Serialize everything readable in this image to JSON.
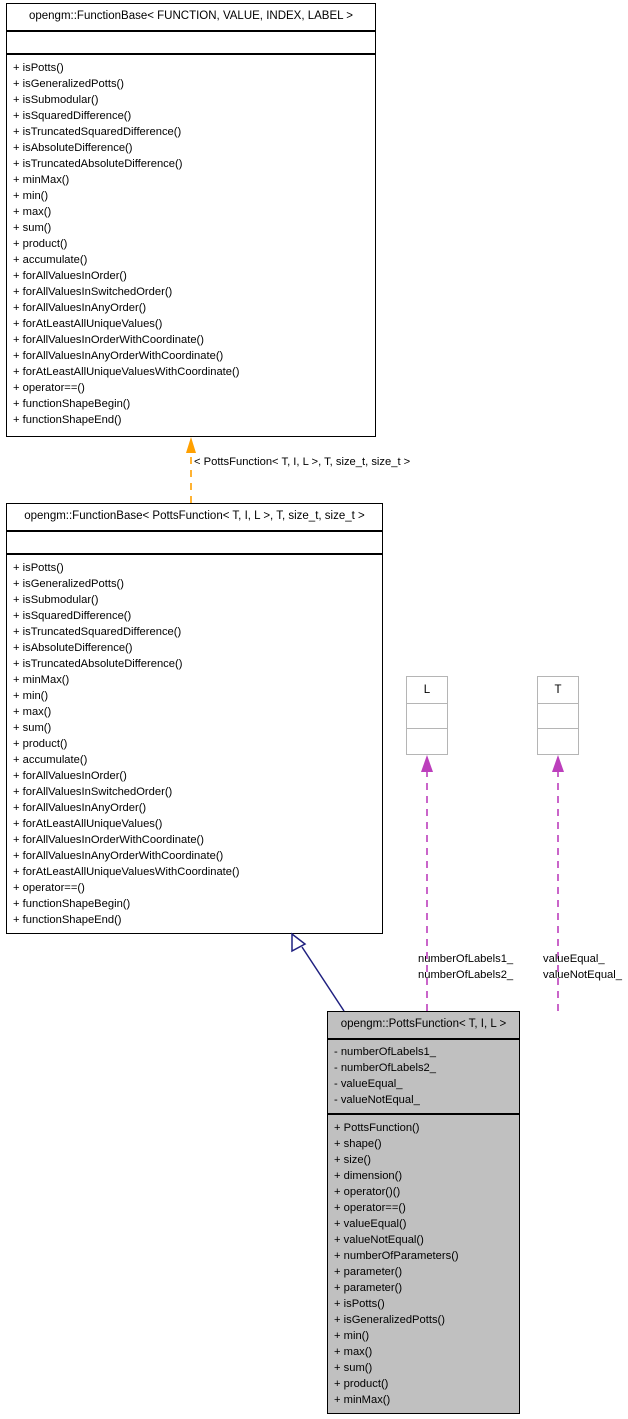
{
  "diagram": {
    "kind": "uml-class-inheritance-diagram",
    "colors": {
      "generalization_dashed_orange": "#ffa000",
      "generalization_solid_navy": "#1f2080",
      "template_binding_purple": "#bc3fbc",
      "box_fill_gray": "#c0c0c0",
      "box_border_black": "#000000",
      "template_box_border_gray": "#b5b5b5"
    },
    "classes": [
      {
        "id": "function-base-generic",
        "title": "opengm::FunctionBase< FUNCTION, VALUE, INDEX, LABEL >",
        "attributes": [],
        "operations": [
          "+ isPotts()",
          "+ isGeneralizedPotts()",
          "+ isSubmodular()",
          "+ isSquaredDifference()",
          "+ isTruncatedSquaredDifference()",
          "+ isAbsoluteDifference()",
          "+ isTruncatedAbsoluteDifference()",
          "+ minMax()",
          "+ min()",
          "+ max()",
          "+ sum()",
          "+ product()",
          "+ accumulate()",
          "+ forAllValuesInOrder()",
          "+ forAllValuesInSwitchedOrder()",
          "+ forAllValuesInAnyOrder()",
          "+ forAtLeastAllUniqueValues()",
          "+ forAllValuesInOrderWithCoordinate()",
          "+ forAllValuesInAnyOrderWithCoordinate()",
          "+ forAtLeastAllUniqueValuesWithCoordinate()",
          "+ operator==()",
          "+ functionShapeBegin()",
          "+ functionShapeEnd()"
        ]
      },
      {
        "id": "function-base-potts",
        "title": "opengm::FunctionBase< PottsFunction< T, I, L >, T, size_t, size_t >",
        "attributes": [],
        "operations": [
          "+ isPotts()",
          "+ isGeneralizedPotts()",
          "+ isSubmodular()",
          "+ isSquaredDifference()",
          "+ isTruncatedSquaredDifference()",
          "+ isAbsoluteDifference()",
          "+ isTruncatedAbsoluteDifference()",
          "+ minMax()",
          "+ min()",
          "+ max()",
          "+ sum()",
          "+ product()",
          "+ accumulate()",
          "+ forAllValuesInOrder()",
          "+ forAllValuesInSwitchedOrder()",
          "+ forAllValuesInAnyOrder()",
          "+ forAtLeastAllUniqueValues()",
          "+ forAllValuesInOrderWithCoordinate()",
          "+ forAllValuesInAnyOrderWithCoordinate()",
          "+ forAtLeastAllUniqueValuesWithCoordinate()",
          "+ operator==()",
          "+ functionShapeBegin()",
          "+ functionShapeEnd()"
        ]
      },
      {
        "id": "potts-function",
        "title": "opengm::PottsFunction< T, I, L >",
        "attributes": [
          "- numberOfLabels1_",
          "- numberOfLabels2_",
          "- valueEqual_",
          "- valueNotEqual_"
        ],
        "operations": [
          "+ PottsFunction()",
          "+ shape()",
          "+ size()",
          "+ dimension()",
          "+ operator()()",
          "+ operator==()",
          "+ valueEqual()",
          "+ valueNotEqual()",
          "+ numberOfParameters()",
          "+ parameter()",
          "+ parameter()",
          "+ isPotts()",
          "+ isGeneralizedPotts()",
          "+ min()",
          "+ max()",
          "+ sum()",
          "+ product()",
          "+ minMax()"
        ]
      }
    ],
    "template_params": [
      {
        "id": "tpl-L",
        "label": "L"
      },
      {
        "id": "tpl-T",
        "label": "T"
      }
    ],
    "edge_labels": {
      "generic_binding": "< PottsFunction< T, I, L >, T, size_t, size_t >",
      "labels_binding_line1": "numberOfLabels1_",
      "labels_binding_line2": "numberOfLabels2_",
      "values_binding_line1": "valueEqual_",
      "values_binding_line2": "valueNotEqual_"
    }
  }
}
